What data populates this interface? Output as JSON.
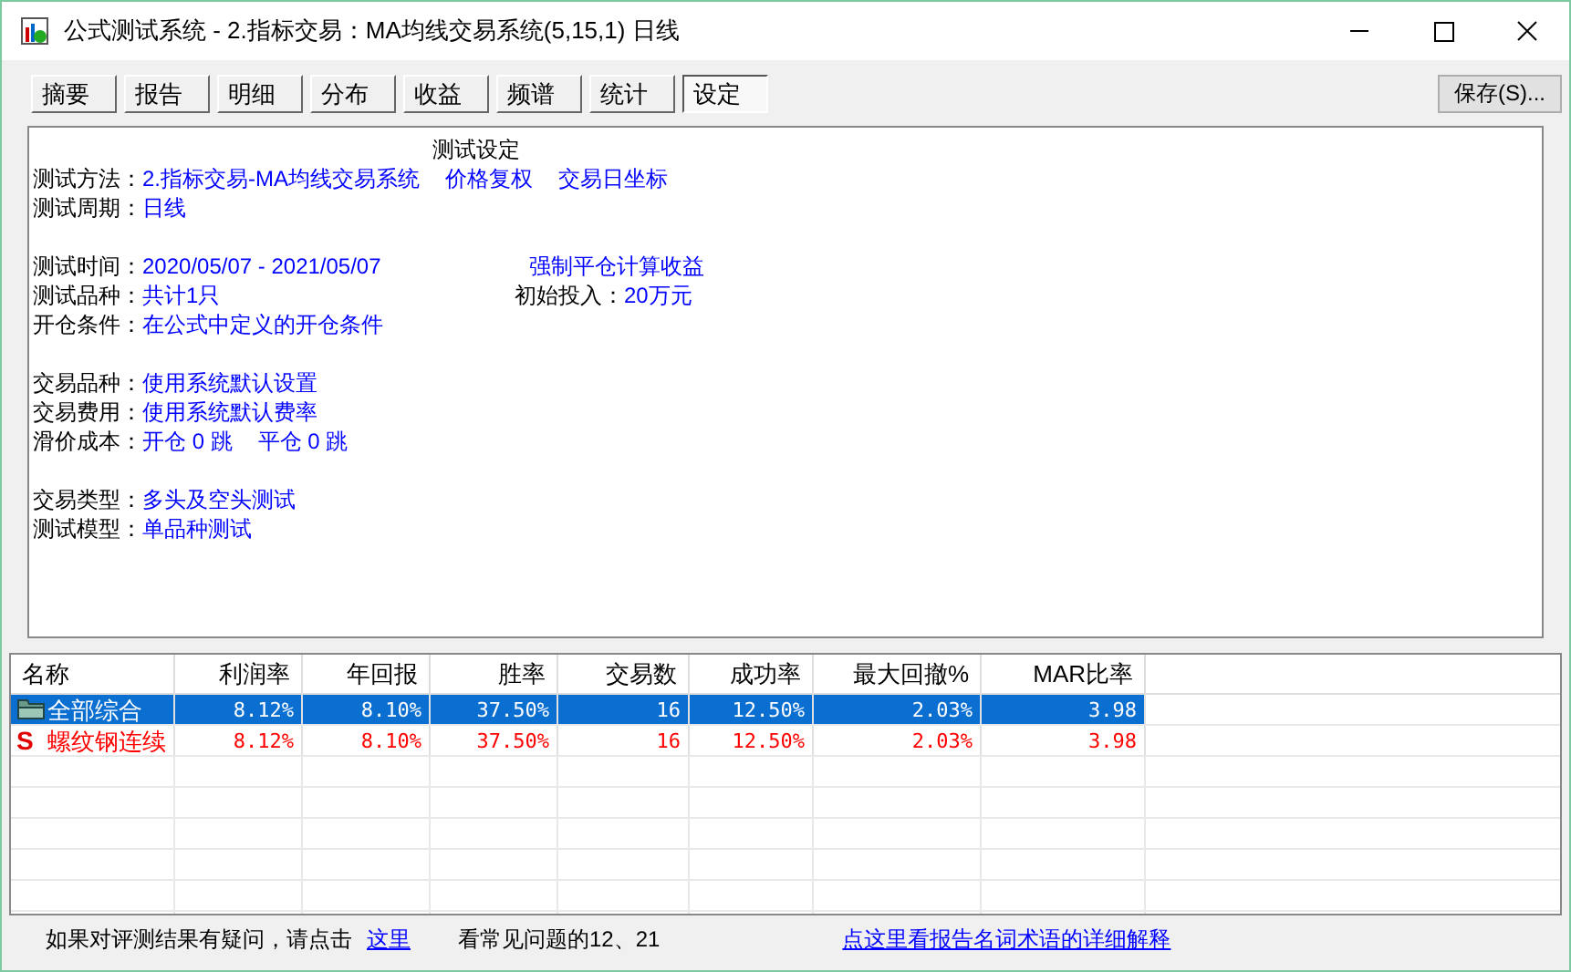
{
  "window": {
    "title": "公式测试系统 - 2.指标交易：MA均线交易系统(5,15,1) 日线"
  },
  "tabs": [
    {
      "label": "摘要",
      "selected": false
    },
    {
      "label": "报告",
      "selected": false
    },
    {
      "label": "明细",
      "selected": false
    },
    {
      "label": "分布",
      "selected": false
    },
    {
      "label": "收益",
      "selected": false
    },
    {
      "label": "频谱",
      "selected": false
    },
    {
      "label": "统计",
      "selected": false
    },
    {
      "label": "设定",
      "selected": true
    }
  ],
  "save_button": "保存(S)...",
  "report": {
    "title": "测试设定",
    "groups": [
      [
        {
          "label": "测试方法：",
          "values": [
            "2.指标交易-MA均线交易系统",
            "价格复权",
            "交易日坐标"
          ]
        },
        {
          "label": "测试周期：",
          "values": [
            "日线"
          ]
        }
      ],
      [
        {
          "label": "测试时间：",
          "values": [
            "2020/05/07 - 2021/05/07"
          ],
          "right_value": "强制平仓计算收益"
        },
        {
          "label": "测试品种：",
          "values": [
            "共计1只"
          ],
          "right_label": "初始投入：",
          "right_value": "20万元"
        },
        {
          "label": "开仓条件：",
          "values": [
            "在公式中定义的开仓条件"
          ]
        }
      ],
      [
        {
          "label": "交易品种：",
          "values": [
            "使用系统默认设置"
          ]
        },
        {
          "label": "交易费用：",
          "values": [
            "使用系统默认费率"
          ]
        },
        {
          "label": "滑价成本：",
          "values": [
            "开仓 0 跳",
            "平仓 0 跳"
          ]
        }
      ],
      [
        {
          "label": "交易类型：",
          "values": [
            "多头及空头测试"
          ]
        },
        {
          "label": "测试模型：",
          "values": [
            "单品种测试"
          ]
        }
      ]
    ]
  },
  "table": {
    "columns": [
      "名称",
      "利润率",
      "年回报",
      "胜率",
      "交易数",
      "成功率",
      "最大回撤%",
      "MAR比率"
    ],
    "rows": [
      {
        "kind": "summary",
        "selected": true,
        "cells": [
          "全部综合",
          "8.12%",
          "8.10%",
          "37.50%",
          "16",
          "12.50%",
          "2.03%",
          "3.98"
        ]
      },
      {
        "kind": "symbol",
        "selected": false,
        "marker": "S",
        "cells": [
          "螺纹钢连续",
          "8.12%",
          "8.10%",
          "37.50%",
          "16",
          "12.50%",
          "2.03%",
          "3.98"
        ]
      }
    ]
  },
  "status_bar": {
    "text": "如果对评测结果有疑问，请点击",
    "link": "这里",
    "text_2": "看常见问题的12、21",
    "link_2": "点这里看报告名词术语的详细解释"
  }
}
